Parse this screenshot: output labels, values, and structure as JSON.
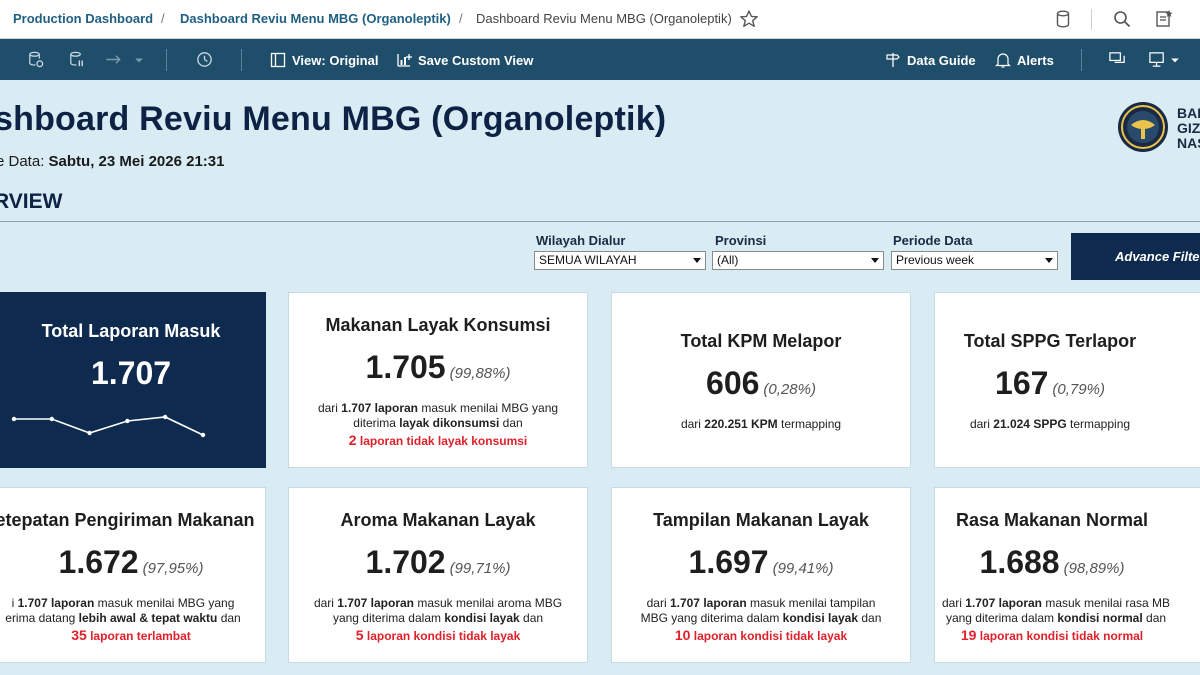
{
  "breadcrumb": {
    "root": "Production Dashboard",
    "parent": "Dashboard Reviu Menu MBG (Organoleptik)",
    "current": "Dashboard Reviu Menu MBG (Organoleptik)",
    "separator": "/"
  },
  "toolbar": {
    "view_label": "View: Original",
    "save_label": "Save Custom View",
    "data_guide_label": "Data Guide",
    "alerts_label": "Alerts"
  },
  "dashboard": {
    "title": "shboard Reviu Menu MBG (Organoleptik)",
    "update_prefix": "e Data:",
    "update_value": "Sabtu, 23 Mei 2026 21:31",
    "section": "RVIEW",
    "logo_text_1": "BAD",
    "logo_text_2": "GIZ",
    "logo_text_3": "NAS"
  },
  "filters": {
    "wilayah": {
      "label": "Wilayah Dialur",
      "value": "SEMUA WILAYAH"
    },
    "provinsi": {
      "label": "Provinsi",
      "value": "(All)"
    },
    "periode": {
      "label": "Periode Data",
      "value": "Previous week"
    },
    "advance_label": "Advance Filte"
  },
  "cards": {
    "total": {
      "title": "Total Laporan Masuk",
      "value": "1.707",
      "sparkline": [
        0.6,
        0.6,
        0.25,
        0.55,
        0.65,
        0.2
      ]
    },
    "layak": {
      "title": "Makanan Layak Konsumsi",
      "value": "1.705",
      "pct": "(99,88%)",
      "d1a": "dari ",
      "d1b": "1.707 laporan",
      "d1c": " masuk menilai MBG yang",
      "d2a": "diterima ",
      "d2b": "layak dikonsumsi",
      "d2c": " dan",
      "warn_num": "2",
      "warn_text": " laporan tidak layak konsumsi"
    },
    "kpm": {
      "title": "Total KPM Melapor",
      "value": "606",
      "pct": "(0,28%)",
      "d1a": "dari ",
      "d1b": "220.251 KPM",
      "d1c": " termapping"
    },
    "sppg": {
      "title": "Total SPPG Terlapor",
      "value": "167",
      "pct": "(0,79%)",
      "d1a": "dari ",
      "d1b": "21.024 SPPG",
      "d1c": " termapping"
    },
    "ketepatan": {
      "title": "etepatan Pengiriman Makanan",
      "value": "1.672",
      "pct": "(97,95%)",
      "d1a": "i ",
      "d1b": "1.707 laporan",
      "d1c": " masuk menilai MBG yang",
      "d2a": "erima datang ",
      "d2b": "lebih awal & tepat waktu",
      "d2c": " dan",
      "warn_num": "35",
      "warn_text": " laporan terlambat"
    },
    "aroma": {
      "title": "Aroma Makanan Layak",
      "value": "1.702",
      "pct": "(99,71%)",
      "d1a": "dari ",
      "d1b": "1.707 laporan",
      "d1c": " masuk menilai aroma MBG",
      "d2a": "yang diterima dalam ",
      "d2b": "kondisi layak",
      "d2c": " dan",
      "warn_num": "5",
      "warn_text": " laporan kondisi tidak layak"
    },
    "tampilan": {
      "title": "Tampilan Makanan Layak",
      "value": "1.697",
      "pct": "(99,41%)",
      "d1a": "dari ",
      "d1b": "1.707 laporan",
      "d1c": " masuk menilai tampilan",
      "d2a": "MBG yang diterima dalam ",
      "d2b": "kondisi layak",
      "d2c": " dan",
      "warn_num": "10",
      "warn_text": " laporan kondisi tidak layak"
    },
    "rasa": {
      "title": "Rasa Makanan Normal",
      "value": "1.688",
      "pct": "(98,89%)",
      "d1a": "dari ",
      "d1b": "1.707 laporan",
      "d1c": " masuk menilai rasa MB",
      "d2a": "yang diterima dalam ",
      "d2b": "kondisi normal",
      "d2c": " dan",
      "warn_num": "19",
      "warn_text": " laporan kondisi tidak normal"
    }
  },
  "colors": {
    "navy": "#0f2a4f",
    "toolbar": "#1f4e6b",
    "background": "#d9ebf3",
    "warning_red": "#e0202a"
  }
}
